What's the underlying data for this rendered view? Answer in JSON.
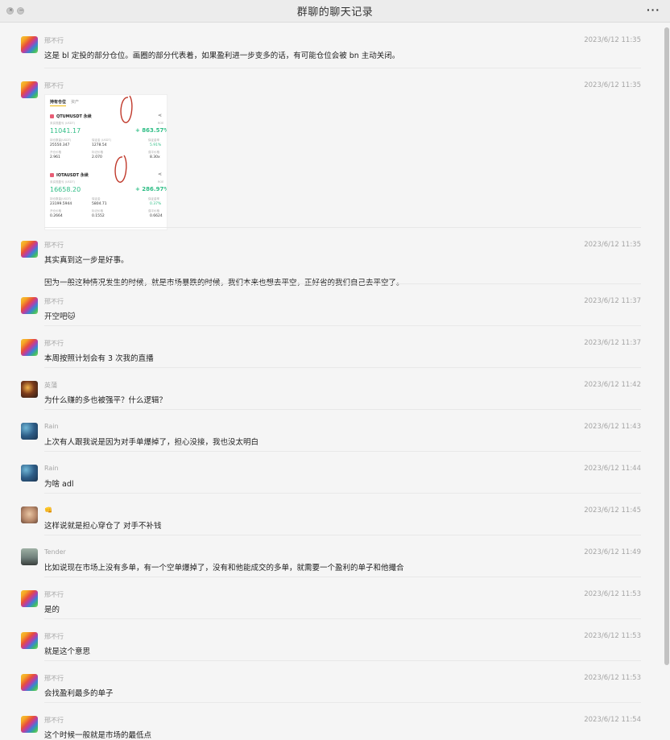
{
  "window": {
    "title": "群聊的聊天记录",
    "more_icon": "ellipsis-icon",
    "close_icon": "close-icon",
    "minimize_icon": "minimize-icon"
  },
  "messages": [
    {
      "sender": "邢不行",
      "time": "2023/6/12 11:35",
      "avatar": "rainbow",
      "lines": [
        "这是 bl 定投的部分仓位。画圈的部分代表着，如果盈利进一步变多的话，有可能仓位会被 bn 主动关闭。"
      ]
    },
    {
      "sender": "邢不行",
      "time": "2023/6/12 11:35",
      "avatar": "rainbow",
      "image": true
    },
    {
      "sender": "邢不行",
      "time": "2023/6/12 11:35",
      "avatar": "rainbow",
      "lines": [
        "其实真到这一步是好事。",
        "因为一般这种情况发生的时候，就是市场暴跌的时候，我们本来也想去平空，正好省的我们自己去平空了。"
      ]
    },
    {
      "sender": "邢不行",
      "time": "2023/6/12 11:37",
      "avatar": "rainbow",
      "lines": [
        "开空吧🐱"
      ]
    },
    {
      "sender": "邢不行",
      "time": "2023/6/12 11:37",
      "avatar": "rainbow",
      "lines": [
        "本周按照计划会有 3 次我的直播"
      ]
    },
    {
      "sender": "英蒲",
      "time": "2023/6/12 11:42",
      "avatar": "dark",
      "lines": [
        "为什么赚的多也被强平？什么逻辑？"
      ]
    },
    {
      "sender": "Rain",
      "time": "2023/6/12 11:43",
      "avatar": "rain",
      "lines": [
        "上次有人跟我说是因为对手单爆掉了，担心没接，我也没太明白"
      ]
    },
    {
      "sender": "Rain",
      "time": "2023/6/12 11:44",
      "avatar": "rain",
      "lines": [
        "为啥 adl"
      ]
    },
    {
      "sender": "👊",
      "time": "2023/6/12 11:45",
      "avatar": "face",
      "lines": [
        "这样说就是担心穿仓了 对手不补钱"
      ]
    },
    {
      "sender": "Tender",
      "time": "2023/6/12 11:49",
      "avatar": "tender",
      "lines": [
        "比如说现在市场上没有多单，有一个空单爆掉了，没有和他能成交的多单，就需要一个盈利的单子和他撮合"
      ]
    },
    {
      "sender": "邢不行",
      "time": "2023/6/12 11:53",
      "avatar": "rainbow",
      "lines": [
        "是的"
      ]
    },
    {
      "sender": "邢不行",
      "time": "2023/6/12 11:53",
      "avatar": "rainbow",
      "lines": [
        "就是这个意思"
      ]
    },
    {
      "sender": "邢不行",
      "time": "2023/6/12 11:53",
      "avatar": "rainbow",
      "lines": [
        "会找盈利最多的单子"
      ]
    },
    {
      "sender": "邢不行",
      "time": "2023/6/12 11:54",
      "avatar": "rainbow",
      "lines": [
        "这个时候一般就是市场的最低点"
      ]
    }
  ],
  "screenshot": {
    "tabs": [
      "持有仓位",
      "资产"
    ],
    "positions": [
      {
        "symbol": "QTUMUSDT 永续",
        "pnl_label": "未实现盈亏 (USDT)",
        "pnl": "11041.17",
        "roe_label": "ROE",
        "roe": "+ 863.57%",
        "size_label": "持仓数量(USDT)",
        "size": "25550.347",
        "margin_label": "保证金 (USDT)",
        "margin": "1278.54",
        "ratio_label": "保证金率",
        "ratio": "5.91%",
        "entry_label": "开仓价格",
        "entry": "2.961",
        "mark_label": "标记价格",
        "mark": "2.070",
        "liq_label": "强平价格",
        "liq": "8.30x"
      },
      {
        "symbol": "IOTAUSDT 永续",
        "pnl_label": "未实现盈亏 (USDT)",
        "pnl": "16658.20",
        "roe_label": "ROE",
        "roe": "+ 286.97%",
        "size_label": "持仓数量(USDT)",
        "size": "23199.5944",
        "margin_label": "保证金",
        "margin": "5804.71",
        "ratio_label": "保证金率",
        "ratio": "0.37%",
        "entry_label": "开仓价格",
        "entry": "0.2664",
        "mark_label": "标记价格",
        "mark": "0.1552",
        "liq_label": "强平价格",
        "liq": "0.6624"
      }
    ],
    "accent_green": "#2ebd85",
    "circle_red": "#c0392b"
  }
}
